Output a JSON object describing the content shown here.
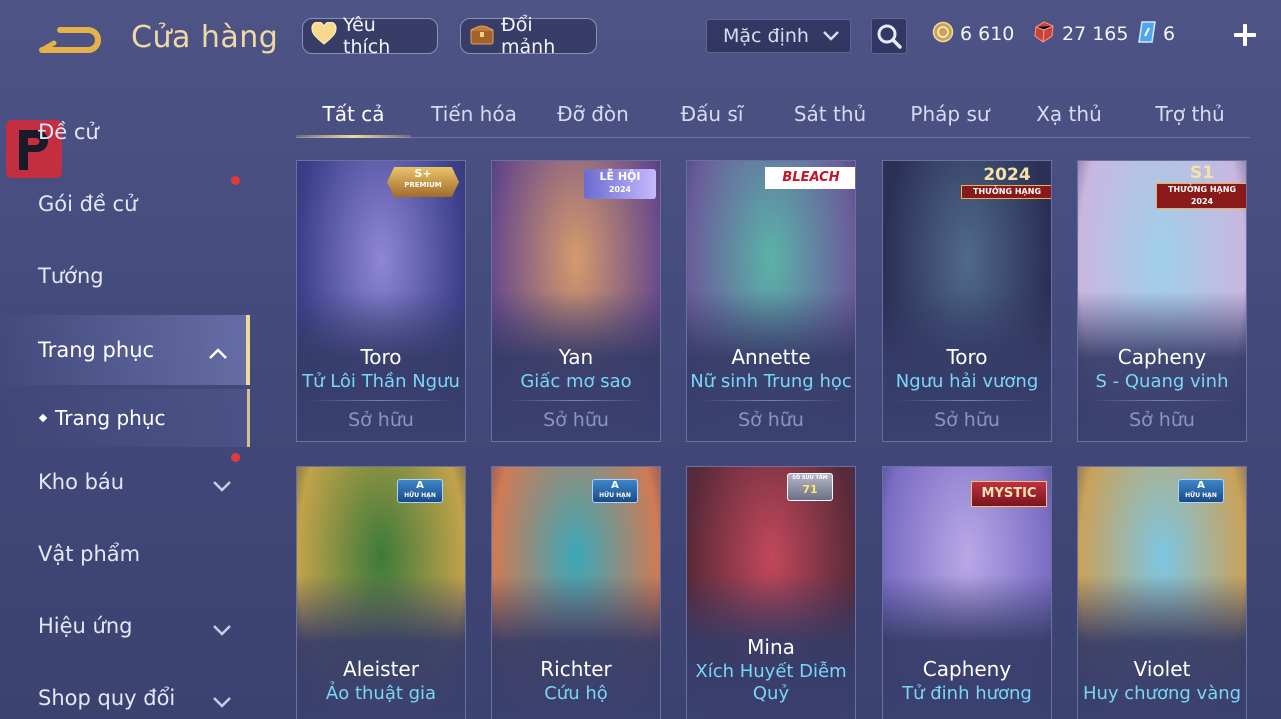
{
  "header": {
    "title": "Cửa hàng",
    "favorite_label": "Yêu thích",
    "shard_label": "Đổi mảnh",
    "sort_value": "Mặc định",
    "currencies": {
      "gold": "6 610",
      "gems": "27 165",
      "vouchers": "6"
    }
  },
  "sidebar": {
    "items": [
      {
        "label": "Đề cử"
      },
      {
        "label": "Gói đề cử"
      },
      {
        "label": "Tướng"
      },
      {
        "label": "Trang phục"
      },
      {
        "label": "Kho báu"
      },
      {
        "label": "Vật phẩm"
      },
      {
        "label": "Hiệu ứng"
      },
      {
        "label": "Shop quy đổi"
      }
    ],
    "sub_item": "Trang phục"
  },
  "tabs": [
    "Tất cả",
    "Tiến hóa",
    "Đỡ đòn",
    "Đấu sĩ",
    "Sát thủ",
    "Pháp sư",
    "Xạ thủ",
    "Trợ thủ"
  ],
  "cards": [
    {
      "hero": "Toro",
      "skin": "Tử Lôi Thần Ngưu",
      "status": "Sở hữu",
      "badge": "S+",
      "badge_sub": "PREMIUM",
      "color1": "#8f86d6",
      "color2": "#3b3f8a"
    },
    {
      "hero": "Yan",
      "skin": "Giấc mơ sao",
      "status": "Sở hữu",
      "badge": "LỄ HỘI",
      "badge_sub": "2024",
      "color1": "#d59a6c",
      "color2": "#6a4b8a"
    },
    {
      "hero": "Annette",
      "skin": "Nữ sinh Trung học",
      "status": "Sở hữu",
      "badge": "BLEACH",
      "badge_sub": "",
      "color1": "#5ab3a8",
      "color2": "#6a5c9a"
    },
    {
      "hero": "Toro",
      "skin": "Ngưu hải vương",
      "status": "Sở hữu",
      "badge": "2024",
      "badge_sub": "THƯỞNG HẠNG",
      "color1": "#4f6a8a",
      "color2": "#2b2f55"
    },
    {
      "hero": "Capheny",
      "skin": "S - Quang vinh",
      "status": "Sở hữu",
      "badge": "S1",
      "badge_sub": "THƯỞNG HẠNG 2024",
      "color1": "#9fd0e8",
      "color2": "#c9b6e0"
    },
    {
      "hero": "Aleister",
      "skin": "Ảo thuật gia",
      "status": "",
      "badge": "A",
      "badge_sub": "HỮU HẠN",
      "color1": "#3d7a3a",
      "color2": "#c2a24a"
    },
    {
      "hero": "Richter",
      "skin": "Cứu hộ",
      "status": "",
      "badge": "A",
      "badge_sub": "HỮU HẠN",
      "color1": "#3aa8b8",
      "color2": "#d07a54"
    },
    {
      "hero": "Mina",
      "skin": "Xích Huyết Diễm Quỷ",
      "status": "",
      "badge": "71",
      "badge_sub": "SỐ SƯU TẦM",
      "color1": "#c2485a",
      "color2": "#5a2a3a"
    },
    {
      "hero": "Capheny",
      "skin": "Tử đinh hương",
      "status": "",
      "badge": "MYSTIC",
      "badge_sub": "",
      "color1": "#b9a8e6",
      "color2": "#7a6cc4"
    },
    {
      "hero": "Violet",
      "skin": "Huy chương vàng",
      "status": "",
      "badge": "A",
      "badge_sub": "HỮU HẠN",
      "color1": "#7cc6e4",
      "color2": "#c9a25a"
    }
  ],
  "colors": {
    "accent_gold": "#f3d79a",
    "skin_name": "#79d6f7",
    "background": "#474d80"
  }
}
